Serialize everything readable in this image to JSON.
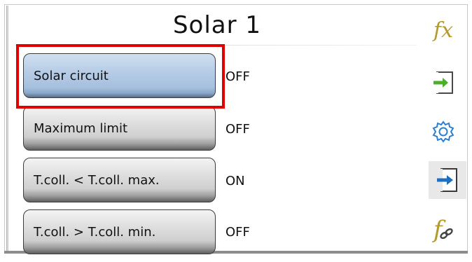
{
  "header": {
    "title": "Solar 1"
  },
  "rows": [
    {
      "label": "Solar circuit",
      "status": "OFF",
      "active": true
    },
    {
      "label": "Maximum limit",
      "status": "OFF",
      "active": false
    },
    {
      "label": "T.coll. < T.coll. max.",
      "status": "ON",
      "active": false
    },
    {
      "label": "T.coll. > T.coll. min.",
      "status": "OFF",
      "active": false
    }
  ],
  "sidebar": {
    "icons": [
      {
        "name": "function-fx-icon",
        "glyph": "fx"
      },
      {
        "name": "input-arrow-icon"
      },
      {
        "name": "gear-icon"
      },
      {
        "name": "output-arrow-icon",
        "selected": true
      },
      {
        "name": "function-link-icon",
        "glyph": "f"
      }
    ]
  },
  "colors": {
    "highlight": "#e10000",
    "active_button": "#a5bfdd",
    "inactive_button": "#cfcfcf",
    "icon_gold": "#b59a2a",
    "arrow_green": "#4caf2a",
    "arrow_blue": "#1f6fc0"
  }
}
